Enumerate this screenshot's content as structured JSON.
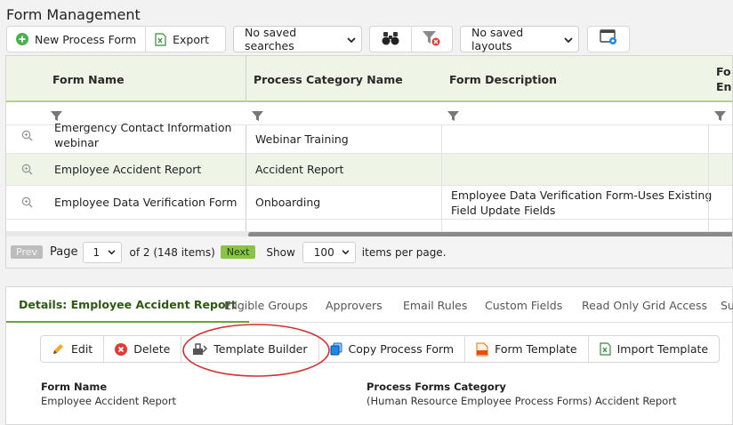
{
  "page": {
    "title": "Form Management"
  },
  "toolbar": {
    "new_label": "New Process Form",
    "export_label": "Export",
    "saved_searches": "No saved searches",
    "saved_layouts": "No saved layouts"
  },
  "grid": {
    "columns": [
      "Form Name",
      "Process Category Name",
      "Form Description",
      "Fo",
      "En"
    ],
    "rows": [
      {
        "name_line1": "Emergency Contact Information",
        "name_line2": "webinar",
        "category": "Webinar Training",
        "description1": "",
        "description2": ""
      },
      {
        "name_line1": "Employee Accident Report",
        "name_line2": "",
        "category": "Accident Report",
        "description1": "",
        "description2": ""
      },
      {
        "name_line1": "Employee Data Verification Form",
        "name_line2": "",
        "category": "Onboarding",
        "description1": "Employee Data Verification Form-Uses Existing",
        "description2": "Field Update Fields"
      }
    ]
  },
  "pager": {
    "prev": "Prev",
    "page_label": "Page",
    "page_value": "1",
    "of_text": "of 2 (148 items)",
    "next": "Next",
    "show_label": "Show",
    "show_value": "100",
    "per_page": "items per page."
  },
  "details": {
    "tabs": [
      "Details: Employee Accident Report",
      "Eligible Groups",
      "Approvers",
      "Email Rules",
      "Custom Fields",
      "Read Only Grid Access",
      "Su"
    ],
    "buttons": [
      "Edit",
      "Delete",
      "Template Builder",
      "Copy Process Form",
      "Form Template",
      "Import Template"
    ],
    "form_name_label": "Form Name",
    "form_name_value": "Employee Accident Report",
    "category_label": "Process Forms Category",
    "category_value": "(Human Resource Employee Process Forms) Accident Report"
  },
  "colors": {
    "accent": "#6fa33a",
    "header_bg": "#eef4e6",
    "selected_row": "#eef4e6",
    "highlight_circle": "#d32f2f",
    "next_button": "#8bc34a"
  }
}
